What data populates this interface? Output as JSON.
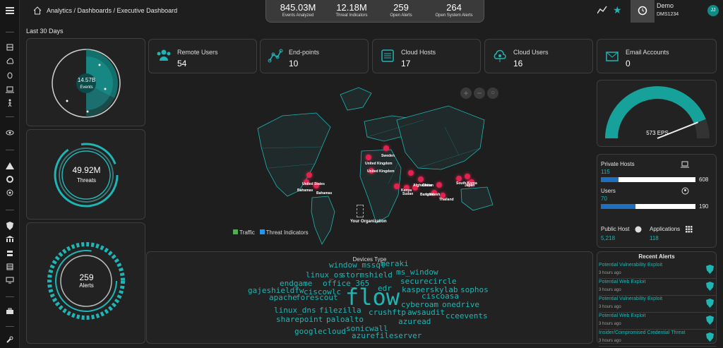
{
  "breadcrumb": "Analytics / Dashboards / Executive Dashboard",
  "stats": [
    {
      "value": "845.03M",
      "label": "Events Analyzed"
    },
    {
      "value": "12.18M",
      "label": "Threat Indicators"
    },
    {
      "value": "259",
      "label": "Open Alerts"
    },
    {
      "value": "264",
      "label": "Open System Alerts"
    }
  ],
  "user": {
    "name": "Demo",
    "id": "DMS1234",
    "initials": "JJ"
  },
  "period": "Last 30 Days",
  "gauges": {
    "events": {
      "value": "14.57B",
      "label": "Events"
    },
    "threats": {
      "value": "49.92M",
      "label": "Threats"
    },
    "alerts": {
      "value": "259",
      "label": "Alerts"
    }
  },
  "kpis": [
    {
      "label": "Remote Users",
      "value": "54",
      "icon": "users-icon"
    },
    {
      "label": "End-points",
      "value": "10",
      "icon": "network-icon"
    },
    {
      "label": "Cloud Hosts",
      "value": "17",
      "icon": "server-icon"
    },
    {
      "label": "Cloud Users",
      "value": "16",
      "icon": "cloud-user-icon"
    },
    {
      "label": "Email Accounts",
      "value": "0",
      "icon": "mail-icon"
    }
  ],
  "eps": {
    "value": "573 EPS",
    "fraction": 0.88
  },
  "hosts": {
    "private_label": "Private Hosts",
    "private_value": "115",
    "private_total": "608",
    "users_label": "Users",
    "users_value": "70",
    "users_total": "190"
  },
  "public": {
    "host_label": "Public Host",
    "host_value": "5,218",
    "apps_label": "Applications",
    "apps_value": "118"
  },
  "map": {
    "legend_traffic": "Traffic",
    "legend_threat": "Threat Indicators",
    "org_label": "Your Organization",
    "colors": {
      "traffic": "#4caf50",
      "threat": "#2196f3",
      "hotspot": "#e3234f"
    },
    "countries": [
      "United States",
      "Bahamas",
      "United Kingdom",
      "Sweden",
      "Kenya",
      "Sudan",
      "Afghanistan",
      "Pakistan",
      "India",
      "China",
      "Bangladesh",
      "Thailand",
      "South Korea",
      "Japan"
    ]
  },
  "wordcloud": {
    "title": "Devices Type",
    "words": [
      "window_mssql",
      "meraki",
      "linux_os",
      "stormshield",
      "ms_window",
      "endgame",
      "office_365",
      "securecircle",
      "gajeshieldfw",
      "ciscowlc",
      "edr",
      "kasperskylab",
      "sophos",
      "apache",
      "forescout",
      "flow",
      "ciscoasa",
      "cyberoam",
      "onedrive",
      "linux_dns",
      "filezilla",
      "crushftp",
      "awsaudit",
      "cceevents",
      "sharepoint",
      "paloalto",
      "azuread",
      "sonicwall",
      "googlecloud",
      "azurefileserver"
    ]
  },
  "alerts": {
    "title": "Recent Alerts",
    "items": [
      {
        "title": "Potential Vulnerability Exploit",
        "time": "3 hours ago"
      },
      {
        "title": "Potential Web Exploit",
        "time": "3 hours ago"
      },
      {
        "title": "Potential Vulnerability Exploit",
        "time": "3 hours ago"
      },
      {
        "title": "Potential Web Exploit",
        "time": "3 hours ago"
      },
      {
        "title": "Insider/Compromised Credential Threat",
        "time": "3 hours ago"
      }
    ]
  }
}
